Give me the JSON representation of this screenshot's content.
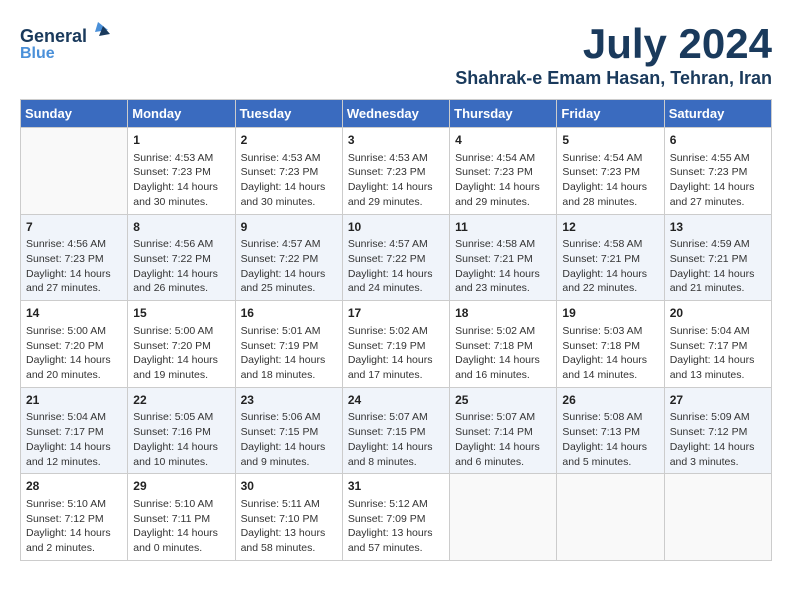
{
  "logo": {
    "general": "General",
    "blue": "Blue"
  },
  "title": {
    "month_year": "July 2024",
    "location": "Shahrak-e Emam Hasan, Tehran, Iran"
  },
  "headers": [
    "Sunday",
    "Monday",
    "Tuesday",
    "Wednesday",
    "Thursday",
    "Friday",
    "Saturday"
  ],
  "weeks": [
    [
      {
        "day": "",
        "info": ""
      },
      {
        "day": "1",
        "info": "Sunrise: 4:53 AM\nSunset: 7:23 PM\nDaylight: 14 hours\nand 30 minutes."
      },
      {
        "day": "2",
        "info": "Sunrise: 4:53 AM\nSunset: 7:23 PM\nDaylight: 14 hours\nand 30 minutes."
      },
      {
        "day": "3",
        "info": "Sunrise: 4:53 AM\nSunset: 7:23 PM\nDaylight: 14 hours\nand 29 minutes."
      },
      {
        "day": "4",
        "info": "Sunrise: 4:54 AM\nSunset: 7:23 PM\nDaylight: 14 hours\nand 29 minutes."
      },
      {
        "day": "5",
        "info": "Sunrise: 4:54 AM\nSunset: 7:23 PM\nDaylight: 14 hours\nand 28 minutes."
      },
      {
        "day": "6",
        "info": "Sunrise: 4:55 AM\nSunset: 7:23 PM\nDaylight: 14 hours\nand 27 minutes."
      }
    ],
    [
      {
        "day": "7",
        "info": "Sunrise: 4:56 AM\nSunset: 7:23 PM\nDaylight: 14 hours\nand 27 minutes."
      },
      {
        "day": "8",
        "info": "Sunrise: 4:56 AM\nSunset: 7:22 PM\nDaylight: 14 hours\nand 26 minutes."
      },
      {
        "day": "9",
        "info": "Sunrise: 4:57 AM\nSunset: 7:22 PM\nDaylight: 14 hours\nand 25 minutes."
      },
      {
        "day": "10",
        "info": "Sunrise: 4:57 AM\nSunset: 7:22 PM\nDaylight: 14 hours\nand 24 minutes."
      },
      {
        "day": "11",
        "info": "Sunrise: 4:58 AM\nSunset: 7:21 PM\nDaylight: 14 hours\nand 23 minutes."
      },
      {
        "day": "12",
        "info": "Sunrise: 4:58 AM\nSunset: 7:21 PM\nDaylight: 14 hours\nand 22 minutes."
      },
      {
        "day": "13",
        "info": "Sunrise: 4:59 AM\nSunset: 7:21 PM\nDaylight: 14 hours\nand 21 minutes."
      }
    ],
    [
      {
        "day": "14",
        "info": "Sunrise: 5:00 AM\nSunset: 7:20 PM\nDaylight: 14 hours\nand 20 minutes."
      },
      {
        "day": "15",
        "info": "Sunrise: 5:00 AM\nSunset: 7:20 PM\nDaylight: 14 hours\nand 19 minutes."
      },
      {
        "day": "16",
        "info": "Sunrise: 5:01 AM\nSunset: 7:19 PM\nDaylight: 14 hours\nand 18 minutes."
      },
      {
        "day": "17",
        "info": "Sunrise: 5:02 AM\nSunset: 7:19 PM\nDaylight: 14 hours\nand 17 minutes."
      },
      {
        "day": "18",
        "info": "Sunrise: 5:02 AM\nSunset: 7:18 PM\nDaylight: 14 hours\nand 16 minutes."
      },
      {
        "day": "19",
        "info": "Sunrise: 5:03 AM\nSunset: 7:18 PM\nDaylight: 14 hours\nand 14 minutes."
      },
      {
        "day": "20",
        "info": "Sunrise: 5:04 AM\nSunset: 7:17 PM\nDaylight: 14 hours\nand 13 minutes."
      }
    ],
    [
      {
        "day": "21",
        "info": "Sunrise: 5:04 AM\nSunset: 7:17 PM\nDaylight: 14 hours\nand 12 minutes."
      },
      {
        "day": "22",
        "info": "Sunrise: 5:05 AM\nSunset: 7:16 PM\nDaylight: 14 hours\nand 10 minutes."
      },
      {
        "day": "23",
        "info": "Sunrise: 5:06 AM\nSunset: 7:15 PM\nDaylight: 14 hours\nand 9 minutes."
      },
      {
        "day": "24",
        "info": "Sunrise: 5:07 AM\nSunset: 7:15 PM\nDaylight: 14 hours\nand 8 minutes."
      },
      {
        "day": "25",
        "info": "Sunrise: 5:07 AM\nSunset: 7:14 PM\nDaylight: 14 hours\nand 6 minutes."
      },
      {
        "day": "26",
        "info": "Sunrise: 5:08 AM\nSunset: 7:13 PM\nDaylight: 14 hours\nand 5 minutes."
      },
      {
        "day": "27",
        "info": "Sunrise: 5:09 AM\nSunset: 7:12 PM\nDaylight: 14 hours\nand 3 minutes."
      }
    ],
    [
      {
        "day": "28",
        "info": "Sunrise: 5:10 AM\nSunset: 7:12 PM\nDaylight: 14 hours\nand 2 minutes."
      },
      {
        "day": "29",
        "info": "Sunrise: 5:10 AM\nSunset: 7:11 PM\nDaylight: 14 hours\nand 0 minutes."
      },
      {
        "day": "30",
        "info": "Sunrise: 5:11 AM\nSunset: 7:10 PM\nDaylight: 13 hours\nand 58 minutes."
      },
      {
        "day": "31",
        "info": "Sunrise: 5:12 AM\nSunset: 7:09 PM\nDaylight: 13 hours\nand 57 minutes."
      },
      {
        "day": "",
        "info": ""
      },
      {
        "day": "",
        "info": ""
      },
      {
        "day": "",
        "info": ""
      }
    ]
  ]
}
